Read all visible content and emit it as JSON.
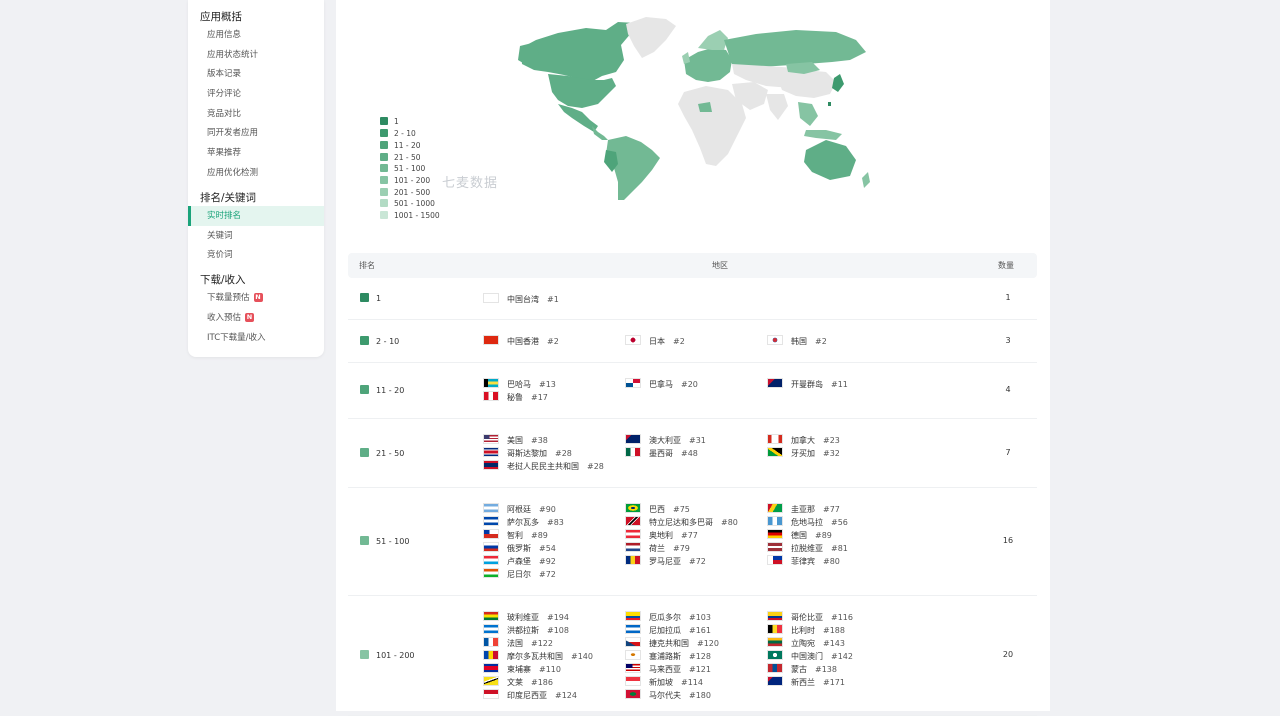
{
  "sidebar": {
    "sections": [
      {
        "title": "应用概括",
        "items": [
          {
            "label": "应用信息"
          },
          {
            "label": "应用状态统计"
          },
          {
            "label": "版本记录"
          },
          {
            "label": "评分评论"
          },
          {
            "label": "竞品对比"
          },
          {
            "label": "同开发者应用"
          },
          {
            "label": "苹果推荐"
          },
          {
            "label": "应用优化检测"
          }
        ]
      },
      {
        "title": "排名/关键词",
        "items": [
          {
            "label": "实时排名",
            "active": true
          },
          {
            "label": "关键词"
          },
          {
            "label": "竞价词"
          }
        ]
      },
      {
        "title": "下载/收入",
        "items": [
          {
            "label": "下载量预估",
            "badge": "N"
          },
          {
            "label": "收入预估",
            "badge": "N"
          },
          {
            "label": "ITC下载量/收入"
          }
        ]
      }
    ]
  },
  "map": {
    "watermark": "七麦数据",
    "legend": [
      {
        "label": "1",
        "color": "#2e8b62"
      },
      {
        "label": "2 - 10",
        "color": "#3d9a6e"
      },
      {
        "label": "11 - 20",
        "color": "#4ea47a"
      },
      {
        "label": "21 - 50",
        "color": "#5fae87"
      },
      {
        "label": "51 - 100",
        "color": "#72b994"
      },
      {
        "label": "101 - 200",
        "color": "#86c4a3"
      },
      {
        "label": "201 - 500",
        "color": "#9bcfb2"
      },
      {
        "label": "501 - 1000",
        "color": "#b2dbc4"
      },
      {
        "label": "1001 - 1500",
        "color": "#c9e6d6"
      }
    ]
  },
  "table": {
    "headers": {
      "rank": "排名",
      "region": "地区",
      "count": "数量"
    },
    "rows": [
      {
        "range": "1",
        "color": "#2e8b62",
        "count": "1",
        "countries": [
          {
            "name": "中国台湾",
            "rank": "#1",
            "flag": "tw"
          }
        ]
      },
      {
        "range": "2 - 10",
        "color": "#3d9a6e",
        "count": "3",
        "countries": [
          {
            "name": "中国香港",
            "rank": "#2",
            "flag": "hk"
          },
          {
            "name": "日本",
            "rank": "#2",
            "flag": "jp"
          },
          {
            "name": "韩国",
            "rank": "#2",
            "flag": "kr"
          }
        ]
      },
      {
        "range": "11 - 20",
        "color": "#4ea47a",
        "count": "4",
        "countries": [
          {
            "name": "巴哈马",
            "rank": "#13",
            "flag": "bs"
          },
          {
            "name": "巴拿马",
            "rank": "#20",
            "flag": "pa"
          },
          {
            "name": "开曼群岛",
            "rank": "#11",
            "flag": "ky"
          },
          {
            "name": "秘鲁",
            "rank": "#17",
            "flag": "pe"
          }
        ]
      },
      {
        "range": "21 - 50",
        "color": "#5fae87",
        "count": "7",
        "countries": [
          {
            "name": "美国",
            "rank": "#38",
            "flag": "us"
          },
          {
            "name": "澳大利亚",
            "rank": "#31",
            "flag": "au"
          },
          {
            "name": "加拿大",
            "rank": "#23",
            "flag": "ca"
          },
          {
            "name": "哥斯达黎加",
            "rank": "#28",
            "flag": "cr"
          },
          {
            "name": "墨西哥",
            "rank": "#48",
            "flag": "mx"
          },
          {
            "name": "牙买加",
            "rank": "#32",
            "flag": "jm"
          },
          {
            "name": "老挝人民民主共和国",
            "rank": "#28",
            "flag": "la"
          }
        ]
      },
      {
        "range": "51 - 100",
        "color": "#72b994",
        "count": "16",
        "countries": [
          {
            "name": "阿根廷",
            "rank": "#90",
            "flag": "ar"
          },
          {
            "name": "巴西",
            "rank": "#75",
            "flag": "br"
          },
          {
            "name": "圭亚那",
            "rank": "#77",
            "flag": "gy"
          },
          {
            "name": "萨尔瓦多",
            "rank": "#83",
            "flag": "sv"
          },
          {
            "name": "特立尼达和多巴哥",
            "rank": "#80",
            "flag": "tt"
          },
          {
            "name": "危地马拉",
            "rank": "#56",
            "flag": "gt"
          },
          {
            "name": "智利",
            "rank": "#89",
            "flag": "cl"
          },
          {
            "name": "奥地利",
            "rank": "#77",
            "flag": "at"
          },
          {
            "name": "德国",
            "rank": "#89",
            "flag": "de"
          },
          {
            "name": "俄罗斯",
            "rank": "#54",
            "flag": "ru"
          },
          {
            "name": "荷兰",
            "rank": "#79",
            "flag": "nl"
          },
          {
            "name": "拉脱维亚",
            "rank": "#81",
            "flag": "lv"
          },
          {
            "name": "卢森堡",
            "rank": "#92",
            "flag": "lu"
          },
          {
            "name": "罗马尼亚",
            "rank": "#72",
            "flag": "ro"
          },
          {
            "name": "菲律宾",
            "rank": "#80",
            "flag": "ph"
          },
          {
            "name": "尼日尔",
            "rank": "#72",
            "flag": "ne"
          }
        ]
      },
      {
        "range": "101 - 200",
        "color": "#86c4a3",
        "count": "20",
        "countries": [
          {
            "name": "玻利维亚",
            "rank": "#194",
            "flag": "bo"
          },
          {
            "name": "厄瓜多尔",
            "rank": "#103",
            "flag": "ec"
          },
          {
            "name": "哥伦比亚",
            "rank": "#116",
            "flag": "co"
          },
          {
            "name": "洪都拉斯",
            "rank": "#108",
            "flag": "hn"
          },
          {
            "name": "尼加拉瓜",
            "rank": "#161",
            "flag": "ni"
          },
          {
            "name": "比利时",
            "rank": "#188",
            "flag": "be"
          },
          {
            "name": "法国",
            "rank": "#122",
            "flag": "fr"
          },
          {
            "name": "捷克共和国",
            "rank": "#120",
            "flag": "cz"
          },
          {
            "name": "立陶宛",
            "rank": "#143",
            "flag": "lt"
          },
          {
            "name": "摩尔多瓦共和国",
            "rank": "#140",
            "flag": "md"
          },
          {
            "name": "塞浦路斯",
            "rank": "#128",
            "flag": "cy"
          },
          {
            "name": "中国澳门",
            "rank": "#142",
            "flag": "mo"
          },
          {
            "name": "柬埔寨",
            "rank": "#110",
            "flag": "kh"
          },
          {
            "name": "马来西亚",
            "rank": "#121",
            "flag": "my"
          },
          {
            "name": "蒙古",
            "rank": "#138",
            "flag": "mn"
          },
          {
            "name": "文莱",
            "rank": "#186",
            "flag": "bn"
          },
          {
            "name": "新加坡",
            "rank": "#114",
            "flag": "sg"
          },
          {
            "name": "新西兰",
            "rank": "#171",
            "flag": "nz"
          },
          {
            "name": "印度尼西亚",
            "rank": "#124",
            "flag": "id"
          },
          {
            "name": "马尔代夫",
            "rank": "#180",
            "flag": "mv"
          }
        ]
      }
    ]
  }
}
